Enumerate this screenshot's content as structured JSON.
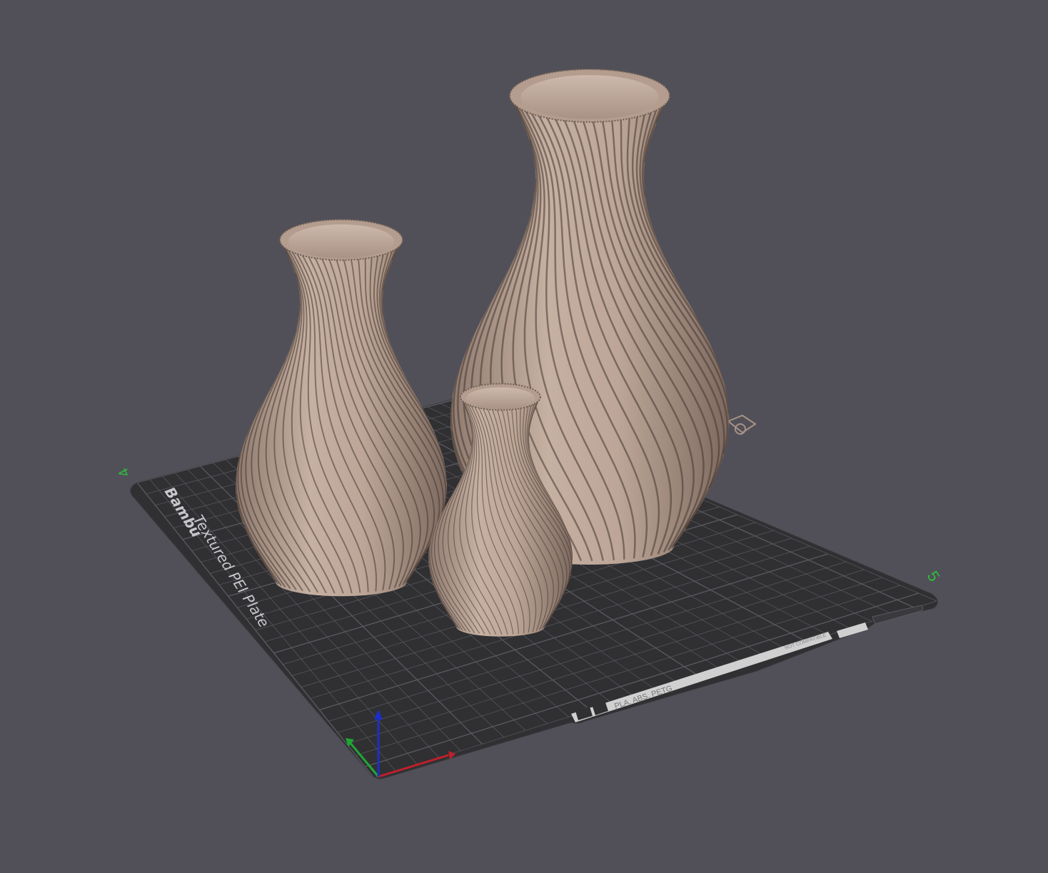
{
  "viewport": {
    "background": "#515058"
  },
  "plate": {
    "brand": "Bambu",
    "label": "Textured PEI Plate",
    "corner_marker_left": "4",
    "corner_marker_right": "5",
    "strip_text": "PLA, ABS, PETG",
    "strip_small_text": "NOT COMPATIBLE",
    "fill_color": "#303033",
    "grid_color": "#5a5a60",
    "marker_color": "#2ebd3c"
  },
  "models": [
    {
      "name": "vase-large",
      "color": "#bfa99a"
    },
    {
      "name": "vase-medium",
      "color": "#bfa99a"
    },
    {
      "name": "vase-small",
      "color": "#bfa99a"
    }
  ],
  "axes": {
    "x_color": "#c0202a",
    "y_color": "#1ea832",
    "z_color": "#1c2ec8"
  }
}
